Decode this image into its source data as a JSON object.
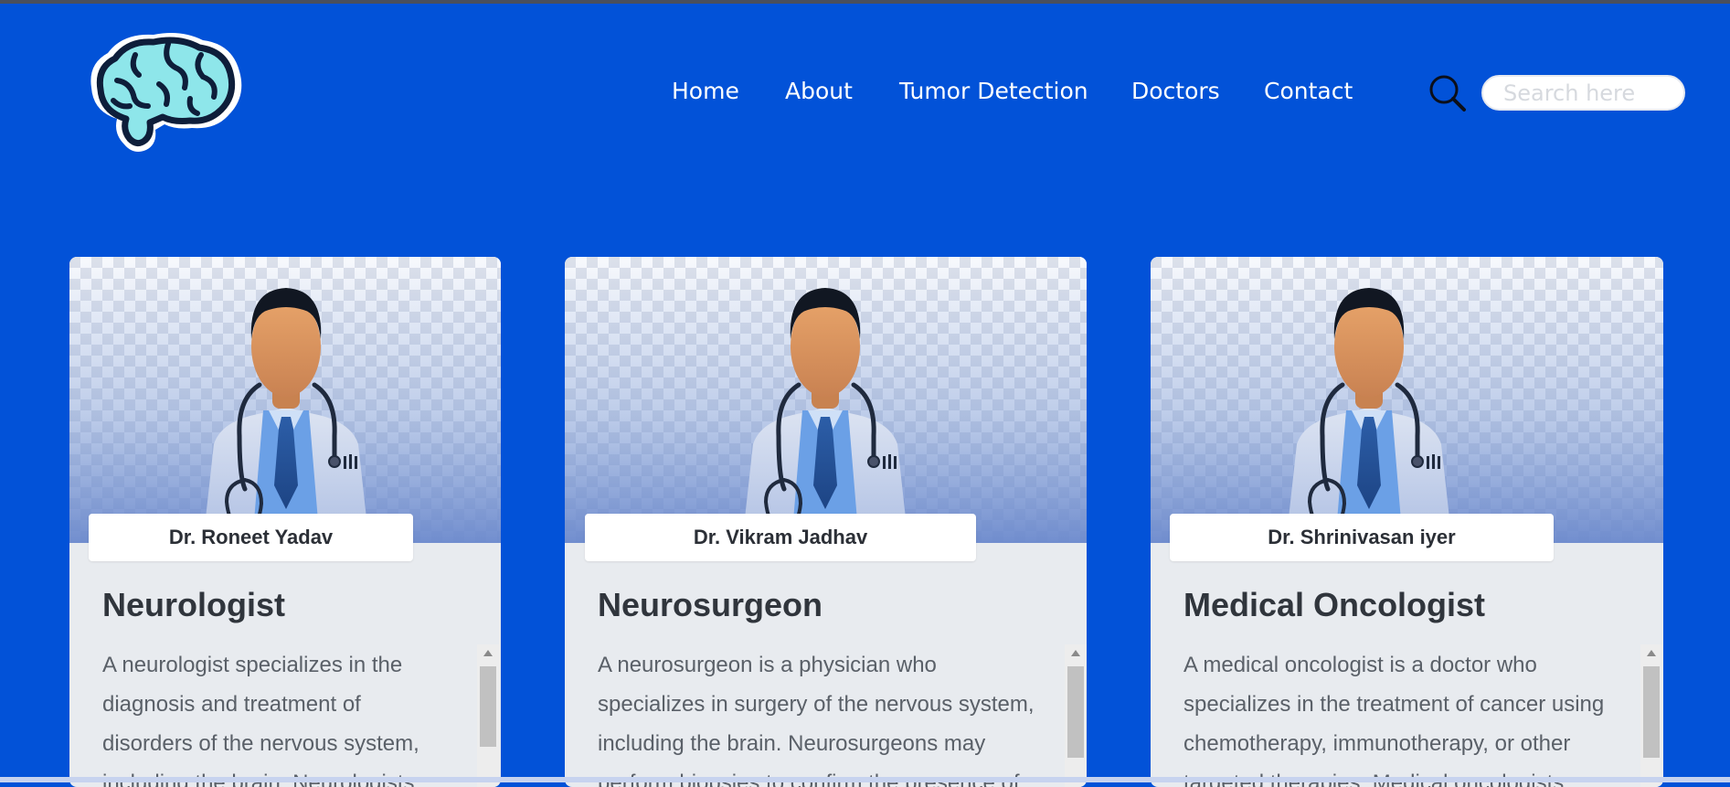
{
  "nav": {
    "items": [
      {
        "label": "Home"
      },
      {
        "label": "About"
      },
      {
        "label": "Tumor Detection"
      },
      {
        "label": "Doctors"
      },
      {
        "label": "Contact"
      }
    ]
  },
  "search": {
    "placeholder": "Search here",
    "icon": "search-icon"
  },
  "logo": {
    "icon": "brain-icon"
  },
  "colors": {
    "background": "#0252d8",
    "nav_text": "#ffffff",
    "card_background": "#e8ebef",
    "brain_fill": "#8ee6ea",
    "brain_outline": "#0e1e3a"
  },
  "doctors": [
    {
      "name": "Dr. Roneet Yadav",
      "specialty": "Neurologist",
      "description_lines": [
        "A neurologist specializes in the",
        "diagnosis and treatment of",
        "disorders of the nervous system,",
        "including the brain. Neurologists"
      ]
    },
    {
      "name": "Dr. Vikram Jadhav",
      "specialty": "Neurosurgeon",
      "description_lines": [
        "A neurosurgeon is a physician who",
        "specializes in surgery of the nervous system,",
        "including the brain. Neurosurgeons may",
        "perform biopsies to confirm the presence of"
      ]
    },
    {
      "name": "Dr. Shrinivasan iyer",
      "specialty": "Medical Oncologist",
      "description_lines": [
        "A medical oncologist is a doctor who",
        "specializes in the treatment of cancer using",
        "chemotherapy, immunotherapy, or other",
        "targeted therapies. Medical oncologists"
      ]
    }
  ]
}
